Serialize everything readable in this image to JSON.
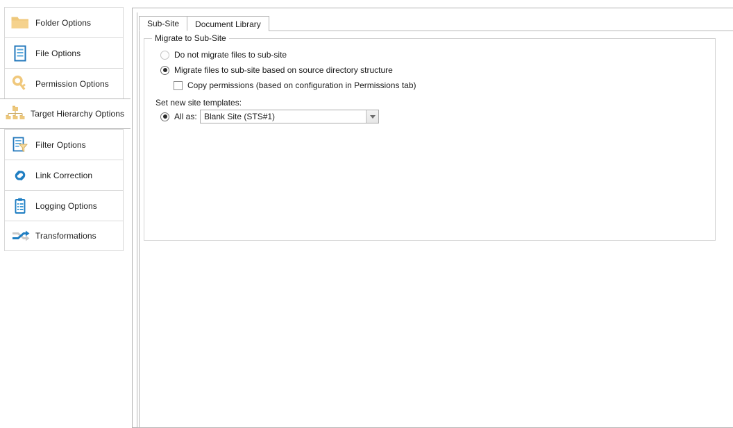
{
  "sidebar": {
    "items": [
      {
        "label": "Folder Options",
        "icon": "folder-icon",
        "selected": false
      },
      {
        "label": "File Options",
        "icon": "file-document-icon",
        "selected": false
      },
      {
        "label": "Permission Options",
        "icon": "key-icon",
        "selected": false
      },
      {
        "label": "Target Hierarchy Options",
        "icon": "hierarchy-tree-icon",
        "selected": true
      },
      {
        "label": "Filter Options",
        "icon": "filter-document-icon",
        "selected": false
      },
      {
        "label": "Link Correction",
        "icon": "chain-link-icon",
        "selected": false
      },
      {
        "label": "Logging Options",
        "icon": "clipboard-icon",
        "selected": false
      },
      {
        "label": "Transformations",
        "icon": "shuffle-arrows-icon",
        "selected": false
      }
    ]
  },
  "tabs": [
    {
      "label": "Sub-Site",
      "active": true
    },
    {
      "label": "Document Library",
      "active": false
    }
  ],
  "subsite": {
    "group_title": "Migrate to Sub-Site",
    "option_no_migrate": {
      "label": "Do not migrate files to sub-site",
      "checked": false
    },
    "option_migrate_structure": {
      "label": "Migrate files to sub-site based on source directory structure",
      "checked": true
    },
    "copy_permissions": {
      "label": "Copy permissions (based on configuration in Permissions tab)",
      "checked": false
    },
    "templates_label": "Set new site templates:",
    "all_as": {
      "label": "All as:",
      "checked": true,
      "value": "Blank Site (STS#1)",
      "options": [
        "Blank Site (STS#1)"
      ]
    }
  },
  "colors": {
    "folder_yellow": "#f2cf81",
    "key_yellow": "#f0cb7e",
    "blue": "#1f7ec2",
    "border": "#b6b6b6",
    "group_border": "#d3d3d3"
  }
}
